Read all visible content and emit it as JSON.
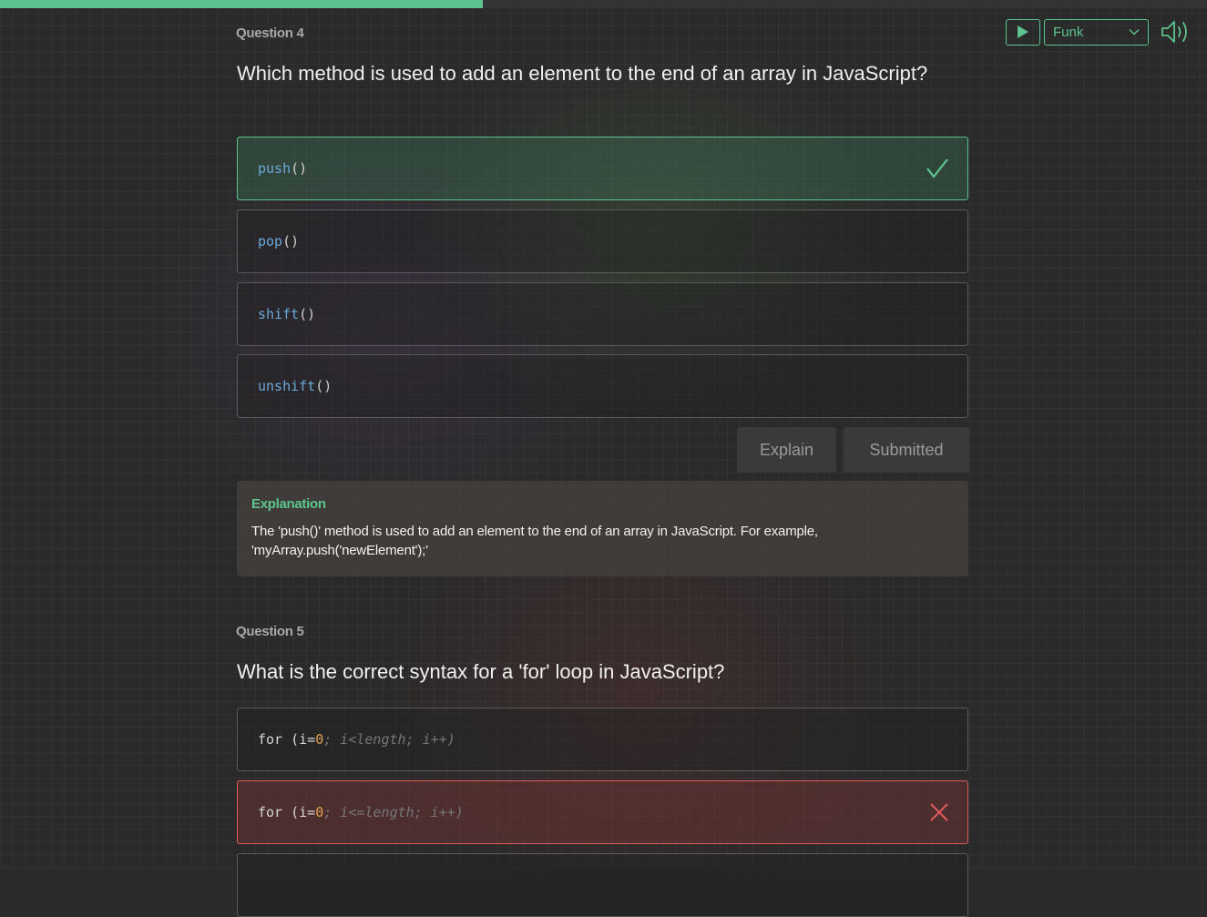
{
  "progress": {
    "fraction": 0.4
  },
  "toolbar": {
    "play_icon": "play-icon",
    "music_select": {
      "value": "Funk",
      "icon": "chevron-down-icon"
    },
    "volume_icon": "volume-icon",
    "accent_color": "#5ec48f"
  },
  "questions": [
    {
      "label": "Question 4",
      "text": "Which method is used to add an element to the end of an array in JavaScript?",
      "options": [
        {
          "fn": "push",
          "paren": "()",
          "state": "correct",
          "icon": "check-icon"
        },
        {
          "fn": "pop",
          "paren": "()",
          "state": "neutral"
        },
        {
          "fn": "shift",
          "paren": "()",
          "state": "neutral"
        },
        {
          "fn": "unshift",
          "paren": "()",
          "state": "neutral"
        }
      ],
      "buttons": {
        "explain": "Explain",
        "submitted": "Submitted"
      },
      "explanation": {
        "title": "Explanation",
        "body": "The 'push()' method is used to add an element to the end of an array in JavaScript. For example, 'myArray.push('newElement');'"
      }
    },
    {
      "label": "Question 5",
      "text": "What is the correct syntax for a 'for' loop in JavaScript?",
      "options": [
        {
          "kw": "for",
          "open": " (i=",
          "num": "0",
          "rest": "; i<length; i++)",
          "state": "neutral"
        },
        {
          "kw": "for",
          "open": " (i=",
          "num": "0",
          "rest": "; i<=length; i++)",
          "state": "wrong",
          "icon": "cross-icon"
        }
      ]
    }
  ],
  "colors": {
    "correct": "#5ec48f",
    "wrong": "#e05c5c",
    "code_fn": "#6aa9d8",
    "code_num": "#e0a050"
  }
}
